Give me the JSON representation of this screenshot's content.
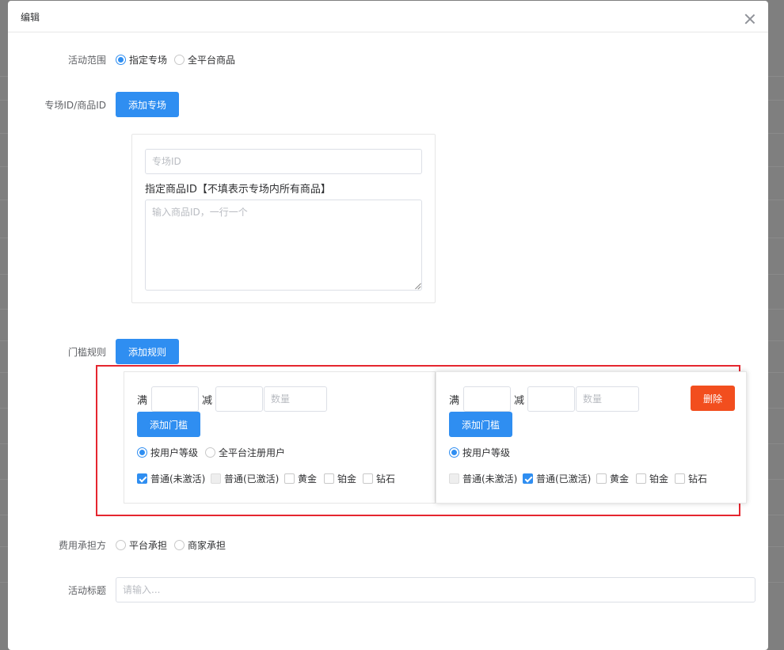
{
  "dialog": {
    "title": "编辑"
  },
  "scope": {
    "label": "活动范围",
    "options": [
      "指定专场",
      "全平台商品"
    ],
    "selected": 0
  },
  "venue": {
    "label": "专场ID/商品ID",
    "add_button": "添加专场",
    "venue_id_placeholder": "专场ID",
    "product_label": "指定商品ID【不填表示专场内所有商品】",
    "product_placeholder": "输入商品ID，一行一个"
  },
  "threshold": {
    "label": "门槛规则",
    "add_button": "添加规则",
    "rules": [
      {
        "full_label": "满",
        "minus_label": "减",
        "full_value": "",
        "minus_value": "",
        "quantity_placeholder": "数量",
        "add_button": "添加门槛",
        "user_options": [
          "按用户等级",
          "全平台注册用户"
        ],
        "user_selected": 0,
        "levels": [
          {
            "label": "普通(未激活)",
            "state": "checked"
          },
          {
            "label": "普通(已激活)",
            "state": "disabled"
          },
          {
            "label": "黄金",
            "state": "unchecked"
          },
          {
            "label": "铂金",
            "state": "unchecked"
          },
          {
            "label": "钻石",
            "state": "unchecked"
          }
        ]
      },
      {
        "full_label": "满",
        "minus_label": "减",
        "full_value": "",
        "minus_value": "",
        "quantity_placeholder": "数量",
        "add_button": "添加门槛",
        "delete_button": "删除",
        "user_options": [
          "按用户等级"
        ],
        "user_selected": 0,
        "levels": [
          {
            "label": "普通(未激活)",
            "state": "disabled"
          },
          {
            "label": "普通(已激活)",
            "state": "checked"
          },
          {
            "label": "黄金",
            "state": "unchecked"
          },
          {
            "label": "铂金",
            "state": "unchecked"
          },
          {
            "label": "钻石",
            "state": "unchecked"
          }
        ]
      }
    ]
  },
  "cost": {
    "label": "费用承担方",
    "options": [
      "平台承担",
      "商家承担"
    ],
    "selected": -1
  },
  "title_field": {
    "label": "活动标题",
    "placeholder": "请输入...",
    "value": ""
  },
  "colors": {
    "primary": "#2f8ef1",
    "danger": "#f24e1e",
    "highlight_border": "#e5262f"
  }
}
